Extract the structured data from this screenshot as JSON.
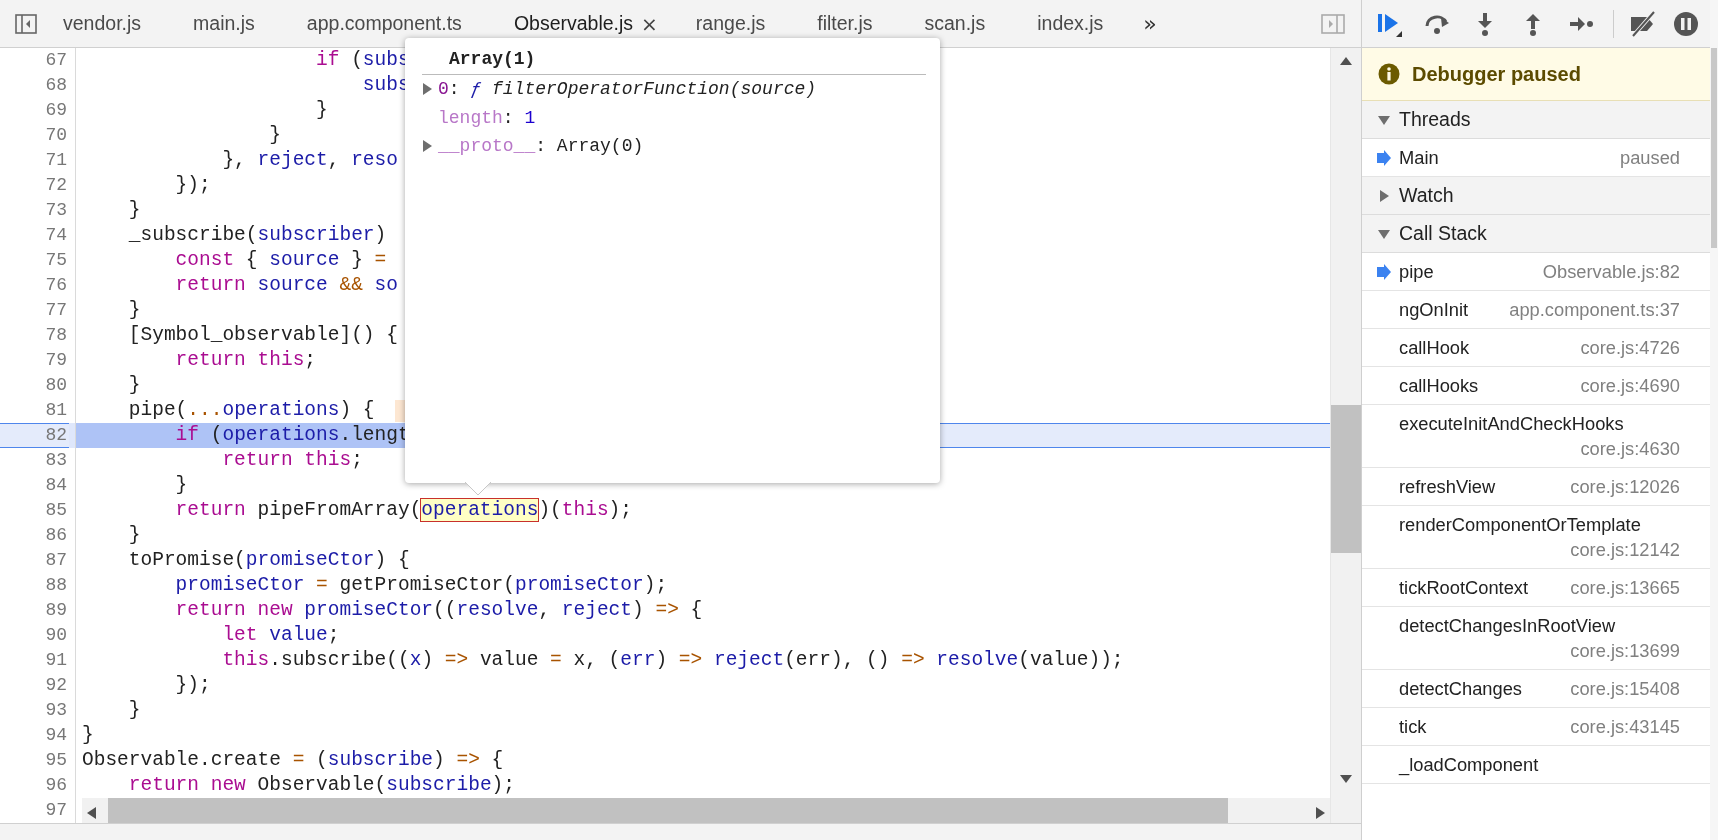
{
  "editor_tabs": [
    {
      "label": "vendor.js",
      "selected": false
    },
    {
      "label": "main.js",
      "selected": false
    },
    {
      "label": "app.component.ts",
      "selected": false
    },
    {
      "label": "Observable.js",
      "selected": true,
      "close": "×"
    },
    {
      "label": "range.js",
      "selected": false
    },
    {
      "label": "filter.js",
      "selected": false
    },
    {
      "label": "scan.js",
      "selected": false
    },
    {
      "label": "index.js",
      "selected": false
    }
  ],
  "overflow_button": "»",
  "code": {
    "lines": [
      {
        "number": "67",
        "current": false,
        "inline_value": false,
        "tokens": [
          {
            "text": "                    if",
            "kind": "keyword"
          },
          {
            "text": " (",
            "kind": "plain"
          },
          {
            "text": "subs",
            "kind": "variable"
          }
        ]
      },
      {
        "number": "68",
        "current": false,
        "inline_value": false,
        "tokens": [
          {
            "text": "                        subs",
            "kind": "variable"
          }
        ]
      },
      {
        "number": "69",
        "current": false,
        "inline_value": false,
        "tokens": [
          {
            "text": "                    }",
            "kind": "plain"
          }
        ]
      },
      {
        "number": "70",
        "current": false,
        "inline_value": false,
        "tokens": [
          {
            "text": "                }",
            "kind": "plain"
          }
        ]
      },
      {
        "number": "71",
        "current": false,
        "inline_value": false,
        "tokens": [
          {
            "text": "            }, ",
            "kind": "plain"
          },
          {
            "text": "reject",
            "kind": "variable"
          },
          {
            "text": ", ",
            "kind": "plain"
          },
          {
            "text": "reso",
            "kind": "variable"
          }
        ]
      },
      {
        "number": "72",
        "current": false,
        "inline_value": false,
        "tokens": [
          {
            "text": "        });",
            "kind": "plain"
          }
        ]
      },
      {
        "number": "73",
        "current": false,
        "inline_value": false,
        "tokens": [
          {
            "text": "    }",
            "kind": "plain"
          }
        ]
      },
      {
        "number": "74",
        "current": false,
        "inline_value": false,
        "tokens": [
          {
            "text": "    _subscribe(",
            "kind": "plain"
          },
          {
            "text": "subscriber",
            "kind": "variable"
          },
          {
            "text": ")",
            "kind": "plain"
          }
        ]
      },
      {
        "number": "75",
        "current": false,
        "inline_value": false,
        "tokens": [
          {
            "text": "        const",
            "kind": "keyword"
          },
          {
            "text": " { ",
            "kind": "plain"
          },
          {
            "text": "source",
            "kind": "variable"
          },
          {
            "text": " } ",
            "kind": "plain"
          },
          {
            "text": "=",
            "kind": "operator"
          }
        ]
      },
      {
        "number": "76",
        "current": false,
        "inline_value": false,
        "tokens": [
          {
            "text": "        return",
            "kind": "keyword"
          },
          {
            "text": " source",
            "kind": "variable"
          },
          {
            "text": " &&",
            "kind": "operator"
          },
          {
            "text": " so",
            "kind": "variable"
          }
        ]
      },
      {
        "number": "77",
        "current": false,
        "inline_value": false,
        "tokens": [
          {
            "text": "    }",
            "kind": "plain"
          }
        ]
      },
      {
        "number": "78",
        "current": false,
        "inline_value": false,
        "tokens": [
          {
            "text": "    [Symbol_observable]() {",
            "kind": "plain"
          }
        ]
      },
      {
        "number": "79",
        "current": false,
        "inline_value": false,
        "tokens": [
          {
            "text": "        return this",
            "kind": "keyword"
          },
          {
            "text": ";",
            "kind": "plain"
          }
        ]
      },
      {
        "number": "80",
        "current": false,
        "inline_value": false,
        "tokens": [
          {
            "text": "    }",
            "kind": "plain"
          }
        ]
      },
      {
        "number": "81",
        "current": false,
        "inline_value": true,
        "tokens": [
          {
            "text": "    pipe(",
            "kind": "plain"
          },
          {
            "text": "...",
            "kind": "operator"
          },
          {
            "text": "operations",
            "kind": "variable"
          },
          {
            "text": ") {",
            "kind": "plain"
          }
        ]
      },
      {
        "number": "82",
        "current": true,
        "inline_value": false,
        "tokens": [
          {
            "text": "        if",
            "kind": "keyword"
          },
          {
            "text": " (",
            "kind": "plain"
          },
          {
            "text": "operations",
            "kind": "variable"
          },
          {
            "text": ".lengt",
            "kind": "plain"
          }
        ]
      },
      {
        "number": "83",
        "current": false,
        "inline_value": false,
        "tokens": [
          {
            "text": "            return this",
            "kind": "keyword"
          },
          {
            "text": ";",
            "kind": "plain"
          }
        ]
      },
      {
        "number": "84",
        "current": false,
        "inline_value": false,
        "tokens": [
          {
            "text": "        }",
            "kind": "plain"
          }
        ]
      },
      {
        "number": "85",
        "current": false,
        "inline_value": false,
        "tokens": [
          {
            "text": "        return",
            "kind": "keyword"
          },
          {
            "text": " pipeFromArray(",
            "kind": "plain"
          },
          {
            "text": "operations",
            "kind": "hovered"
          },
          {
            "text": ")(",
            "kind": "plain"
          },
          {
            "text": "this",
            "kind": "keyword"
          },
          {
            "text": ");",
            "kind": "plain"
          }
        ]
      },
      {
        "number": "86",
        "current": false,
        "inline_value": false,
        "tokens": [
          {
            "text": "    }",
            "kind": "plain"
          }
        ]
      },
      {
        "number": "87",
        "current": false,
        "inline_value": false,
        "tokens": [
          {
            "text": "    toPromise(",
            "kind": "plain"
          },
          {
            "text": "promiseCtor",
            "kind": "variable"
          },
          {
            "text": ") {",
            "kind": "plain"
          }
        ]
      },
      {
        "number": "88",
        "current": false,
        "inline_value": false,
        "tokens": [
          {
            "text": "        promiseCtor",
            "kind": "variable"
          },
          {
            "text": " =",
            "kind": "operator"
          },
          {
            "text": " getPromiseCtor(",
            "kind": "plain"
          },
          {
            "text": "promiseCtor",
            "kind": "variable"
          },
          {
            "text": ");",
            "kind": "plain"
          }
        ]
      },
      {
        "number": "89",
        "current": false,
        "inline_value": false,
        "tokens": [
          {
            "text": "        return new",
            "kind": "keyword"
          },
          {
            "text": " promiseCtor",
            "kind": "variable"
          },
          {
            "text": "((",
            "kind": "plain"
          },
          {
            "text": "resolve",
            "kind": "variable"
          },
          {
            "text": ", ",
            "kind": "plain"
          },
          {
            "text": "reject",
            "kind": "variable"
          },
          {
            "text": ") ",
            "kind": "plain"
          },
          {
            "text": "=>",
            "kind": "operator"
          },
          {
            "text": " {",
            "kind": "plain"
          }
        ]
      },
      {
        "number": "90",
        "current": false,
        "inline_value": false,
        "tokens": [
          {
            "text": "            let",
            "kind": "keyword"
          },
          {
            "text": " value",
            "kind": "variable"
          },
          {
            "text": ";",
            "kind": "plain"
          }
        ]
      },
      {
        "number": "91",
        "current": false,
        "inline_value": false,
        "tokens": [
          {
            "text": "            this",
            "kind": "keyword"
          },
          {
            "text": ".subscribe((",
            "kind": "plain"
          },
          {
            "text": "x",
            "kind": "variable"
          },
          {
            "text": ") ",
            "kind": "plain"
          },
          {
            "text": "=>",
            "kind": "operator"
          },
          {
            "text": " value ",
            "kind": "plain"
          },
          {
            "text": "=",
            "kind": "operator"
          },
          {
            "text": " x, (",
            "kind": "plain"
          },
          {
            "text": "err",
            "kind": "variable"
          },
          {
            "text": ") ",
            "kind": "plain"
          },
          {
            "text": "=>",
            "kind": "operator"
          },
          {
            "text": " reject",
            "kind": "variable"
          },
          {
            "text": "(err), () ",
            "kind": "plain"
          },
          {
            "text": "=>",
            "kind": "operator"
          },
          {
            "text": " resolve",
            "kind": "variable"
          },
          {
            "text": "(value));",
            "kind": "plain"
          }
        ]
      },
      {
        "number": "92",
        "current": false,
        "inline_value": false,
        "tokens": [
          {
            "text": "        });",
            "kind": "plain"
          }
        ]
      },
      {
        "number": "93",
        "current": false,
        "inline_value": false,
        "tokens": [
          {
            "text": "    }",
            "kind": "plain"
          }
        ]
      },
      {
        "number": "94",
        "current": false,
        "inline_value": false,
        "tokens": [
          {
            "text": "}",
            "kind": "plain"
          }
        ]
      },
      {
        "number": "95",
        "current": false,
        "inline_value": false,
        "tokens": [
          {
            "text": "Observable.create ",
            "kind": "plain"
          },
          {
            "text": "=",
            "kind": "operator"
          },
          {
            "text": " (",
            "kind": "plain"
          },
          {
            "text": "subscribe",
            "kind": "variable"
          },
          {
            "text": ") ",
            "kind": "plain"
          },
          {
            "text": "=>",
            "kind": "operator"
          },
          {
            "text": " {",
            "kind": "plain"
          }
        ]
      },
      {
        "number": "96",
        "current": false,
        "inline_value": false,
        "tokens": [
          {
            "text": "    return new",
            "kind": "keyword"
          },
          {
            "text": " Observable(",
            "kind": "plain"
          },
          {
            "text": "subscribe",
            "kind": "variable"
          },
          {
            "text": ");",
            "kind": "plain"
          }
        ]
      },
      {
        "number": "97",
        "current": false,
        "inline_value": false
      }
    ]
  },
  "popover": {
    "title": "Array(1)",
    "properties": [
      {
        "expandable": true,
        "tokens": [
          {
            "text": "0",
            "kind": "property"
          },
          {
            "text": ": ",
            "kind": "plain"
          },
          {
            "text": "ƒ",
            "kind": "function-mark"
          },
          {
            "text": " filterOperatorFunction(source)",
            "kind": "function"
          }
        ]
      },
      {
        "expandable": false,
        "tokens": [
          {
            "text": "length",
            "kind": "property-dim"
          },
          {
            "text": ": ",
            "kind": "plain"
          },
          {
            "text": "1",
            "kind": "number"
          }
        ]
      },
      {
        "expandable": true,
        "tokens": [
          {
            "text": "__proto__",
            "kind": "property-dim"
          },
          {
            "text": ": ",
            "kind": "plain"
          },
          {
            "text": "Array(0)",
            "kind": "plain"
          }
        ]
      }
    ]
  },
  "debugger": {
    "banner": "Debugger paused",
    "sections": [
      {
        "title": "Threads",
        "expanded": true,
        "items": [
          {
            "name": "Main",
            "location": "paused",
            "selected": true
          }
        ]
      },
      {
        "title": "Watch",
        "expanded": false
      },
      {
        "title": "Call Stack",
        "expanded": true,
        "items": [
          {
            "name": "pipe",
            "location": "Observable.js:82",
            "selected": true
          },
          {
            "name": "ngOnInit",
            "location": "app.component.ts:37",
            "selected": false
          },
          {
            "name": "callHook",
            "location": "core.js:4726",
            "selected": false
          },
          {
            "name": "callHooks",
            "location": "core.js:4690",
            "selected": false
          },
          {
            "name": "executeInitAndCheckHooks",
            "location": "core.js:4630",
            "selected": false
          },
          {
            "name": "refreshView",
            "location": "core.js:12026",
            "selected": false
          },
          {
            "name": "renderComponentOrTemplate",
            "location": "core.js:12142",
            "selected": false
          },
          {
            "name": "tickRootContext",
            "location": "core.js:13665",
            "selected": false
          },
          {
            "name": "detectChangesInRootView",
            "location": "core.js:13699",
            "selected": false
          },
          {
            "name": "detectChanges",
            "location": "core.js:15408",
            "selected": false
          },
          {
            "name": "tick",
            "location": "core.js:43145",
            "selected": false
          },
          {
            "name": "_loadComponent",
            "selected": false
          }
        ]
      }
    ]
  }
}
